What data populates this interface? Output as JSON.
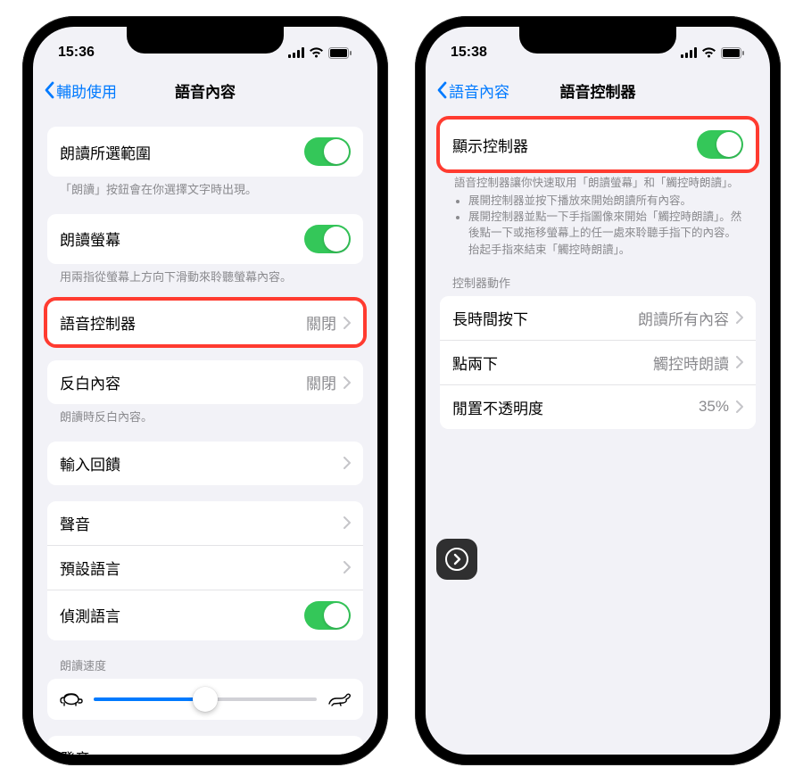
{
  "colors": {
    "accent": "#007aff",
    "toggle_on": "#34c759",
    "highlight": "#ff3b30",
    "bg": "#f2f2f7"
  },
  "left": {
    "status": {
      "time": "15:36"
    },
    "nav": {
      "back_label": "輔助使用",
      "title": "語音內容"
    },
    "speak_selection": {
      "label": "朗讀所選範圍",
      "on": true
    },
    "speak_selection_footer": "「朗讀」按鈕會在你選擇文字時出現。",
    "speak_screen": {
      "label": "朗讀螢幕",
      "on": true
    },
    "speak_screen_footer": "用兩指從螢幕上方向下滑動來聆聽螢幕內容。",
    "speech_controller": {
      "label": "語音控制器",
      "value": "關閉"
    },
    "highlight_content": {
      "label": "反白內容",
      "value": "關閉"
    },
    "highlight_content_footer": "朗讀時反白內容。",
    "typing_feedback": {
      "label": "輸入回饋"
    },
    "voices": {
      "label": "聲音"
    },
    "default_language": {
      "label": "預設語言"
    },
    "detect_languages": {
      "label": "偵測語言",
      "on": true
    },
    "speaking_rate_header": "朗讀速度",
    "icons": {
      "tortoise": "tortoise-icon",
      "hare": "hare-icon"
    },
    "pronunciations": {
      "label": "發音"
    }
  },
  "right": {
    "status": {
      "time": "15:38"
    },
    "nav": {
      "back_label": "語音內容",
      "title": "語音控制器"
    },
    "show_controller": {
      "label": "顯示控制器",
      "on": true
    },
    "description_line1": "語音控制器讓你快速取用「朗讀螢幕」和「觸控時朗讀」。",
    "description_bullet1": "展開控制器並按下播放來開始朗讀所有內容。",
    "description_bullet2": "展開控制器並點一下手指圖像來開始「觸控時朗讀」。然後點一下或拖移螢幕上的任一處來聆聽手指下的內容。抬起手指來結束「觸控時朗讀」。",
    "actions_header": "控制器動作",
    "long_press": {
      "label": "長時間按下",
      "value": "朗讀所有內容"
    },
    "double_tap": {
      "label": "點兩下",
      "value": "觸控時朗讀"
    },
    "idle_opacity": {
      "label": "閒置不透明度",
      "value": "35%"
    }
  }
}
